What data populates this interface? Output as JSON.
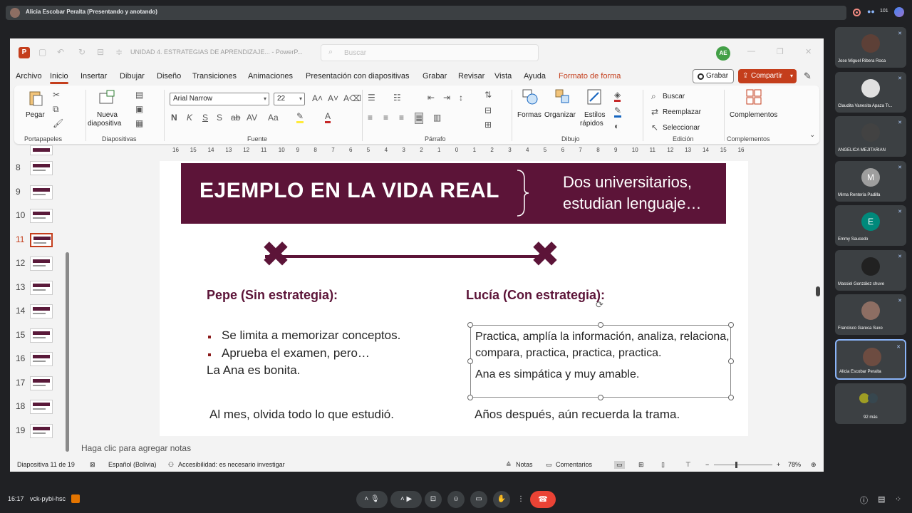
{
  "meet": {
    "presenter_label": "Alicia Escobar Peralta (Presentando y anotando)",
    "participant_count": "101",
    "time": "16:17",
    "meeting_code": "vck-pybi-hsc",
    "more_count": "92 más"
  },
  "ppt": {
    "title": "UNIDAD 4. ESTRATEGIAS DE APRENDIZAJE...  -  PowerP...",
    "search_placeholder": "Buscar",
    "user_initials": "AE",
    "menu": [
      "Archivo",
      "Inicio",
      "Insertar",
      "Dibujar",
      "Diseño",
      "Transiciones",
      "Animaciones",
      "Presentación con diapositivas",
      "Grabar",
      "Revisar",
      "Vista",
      "Ayuda",
      "Formato de forma"
    ],
    "grabar_label": "Grabar",
    "compartir_label": "Compartir",
    "ribbon": {
      "pegar": "Pegar",
      "nueva": "Nueva",
      "diapositiva": "diapositiva",
      "font_name": "Arial Narrow",
      "font_size": "22",
      "formas": "Formas",
      "organizar": "Organizar",
      "estilos": "Estilos",
      "rapidos": "rápidos",
      "buscar": "Buscar",
      "reemplazar": "Reemplazar",
      "seleccionar": "Seleccionar",
      "complementos": "Complementos",
      "groups": [
        "Portapapeles",
        "Diapositivas",
        "Fuente",
        "Párrafo",
        "Dibujo",
        "Edición",
        "Complementos"
      ]
    },
    "ruler": [
      "16",
      "15",
      "14",
      "13",
      "12",
      "11",
      "10",
      "9",
      "8",
      "7",
      "6",
      "5",
      "4",
      "3",
      "2",
      "1",
      "0",
      "1",
      "2",
      "3",
      "4",
      "5",
      "6",
      "7",
      "8",
      "9",
      "10",
      "11",
      "12",
      "13",
      "14",
      "15",
      "16"
    ],
    "slide_numbers": [
      "8",
      "9",
      "10",
      "11",
      "12",
      "13",
      "14",
      "15",
      "16",
      "17",
      "18",
      "19"
    ],
    "notes_placeholder": "Haga clic para agregar notas",
    "status": {
      "slide_of": "Diapositiva 11 de 19",
      "language": "Español (Bolivia)",
      "accessibility": "Accesibilidad: es necesario investigar",
      "notas": "Notas",
      "comentarios": "Comentarios",
      "zoom": "78%"
    }
  },
  "slide": {
    "banner_title": "EJEMPLO EN LA VIDA REAL",
    "banner_text": "Dos universitarios, estudian lenguaje…",
    "left_heading": "Pepe (Sin estrategia):",
    "left_bullet_1": "Se limita a memorizar conceptos.",
    "left_bullet_2": "Aprueba el examen, pero…",
    "left_line_3": "La Ana es bonita.",
    "left_result": "Al mes, olvida todo lo que estudió.",
    "right_heading": "Lucía (Con estrategia):",
    "right_text_1": "Practica, amplía la información, analiza, relaciona, compara, practica, practica, practica.",
    "right_text_2": "Ana es simpática y muy amable.",
    "right_result": "Años después, aún recuerda la trama."
  },
  "participants": [
    {
      "name": "Jose Miguel Ribera Roca",
      "initial": "",
      "color": "#5d4037"
    },
    {
      "name": "Claudita Vanesita Apaza Tr...",
      "initial": "",
      "color": "#e0e0e0"
    },
    {
      "name": "ANGELICA MEJITARIAN",
      "initial": "",
      "color": "#424242"
    },
    {
      "name": "Mirna Rentería Padilla",
      "initial": "M",
      "color": "#9e9e9e"
    },
    {
      "name": "Emmy Saucedo",
      "initial": "E",
      "color": "#00897b"
    },
    {
      "name": "Massiel González chuve",
      "initial": "",
      "color": "#212121"
    },
    {
      "name": "Francisco Gareca Suxo",
      "initial": "",
      "color": "#8d6e63"
    },
    {
      "name": "Alicia Escobar Peralta",
      "initial": "",
      "color": "#6d4c41"
    }
  ]
}
